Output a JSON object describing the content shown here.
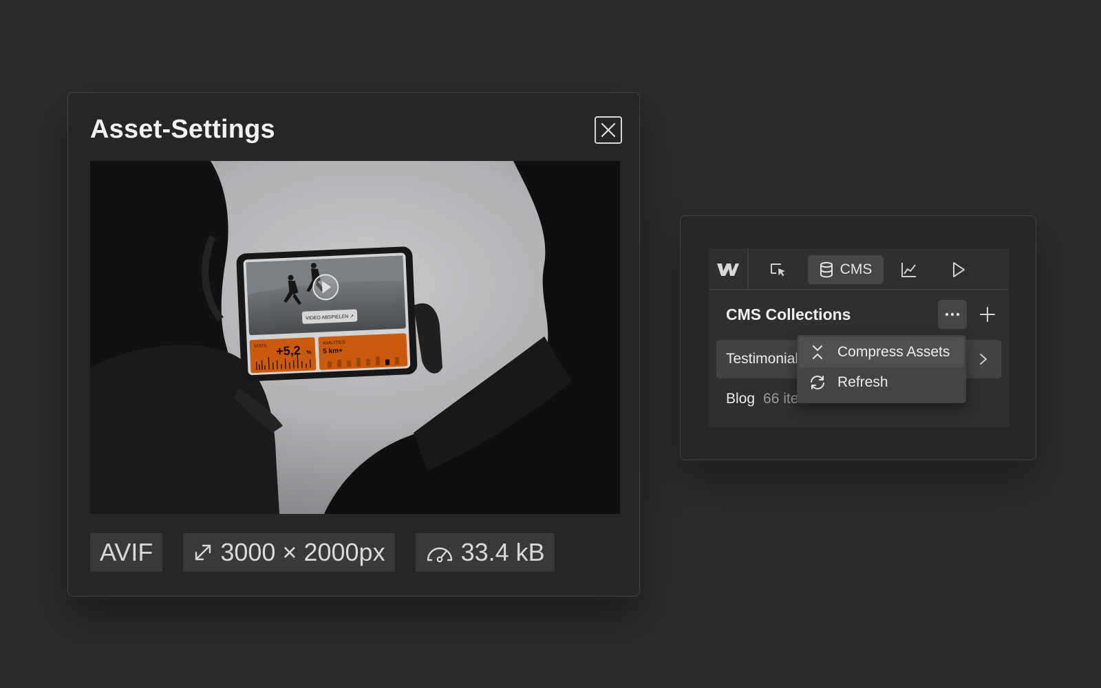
{
  "modal": {
    "title": "Asset-Settings",
    "preview": {
      "tablet": {
        "video_button": "VIDEO ABSPIELEN ↗",
        "stats_label": "STATS",
        "stats_value": "+5,2",
        "stats_unit": "%",
        "analytics_label": "ANALYTICS",
        "analytics_value": "5 km+"
      }
    },
    "chips": {
      "format": "AVIF",
      "dimensions": "3000 × 2000px",
      "filesize": "33.4 kB"
    }
  },
  "cms": {
    "tabs": {
      "cms_label": "CMS"
    },
    "section_title": "CMS Collections",
    "collections": [
      {
        "name": "Testimonials",
        "count": ""
      },
      {
        "name": "Blog",
        "count": "66 items"
      }
    ],
    "menu": {
      "compress_label": "Compress Assets",
      "refresh_label": "Refresh"
    }
  },
  "colors": {
    "background": "#2b2b2b",
    "panel": "#262626",
    "accent_orange": "#e8670e"
  }
}
